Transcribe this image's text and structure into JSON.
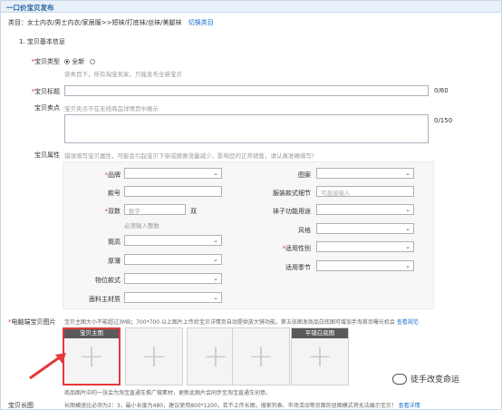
{
  "header": {
    "title": "一口价宝贝发布"
  },
  "category": {
    "prefix": "类目：",
    "path": "女士内衣/男士内衣/家居服>>短袜/打底袜/丝袜/美腿袜",
    "switch_label": "切换类目"
  },
  "section_title": "1. 宝贝基本信息",
  "item_type": {
    "label": "宝贝类型",
    "option_new": "全新",
    "hint": "该类目下，所有淘宝卖家，只能发布全新宝贝"
  },
  "item_title": {
    "label": "宝贝标题",
    "counter": "0/60"
  },
  "selling_point": {
    "label": "宝贝卖点",
    "hint": "宝贝卖点不在无线商品详情页中展示",
    "counter": "0/150"
  },
  "attributes": {
    "label": "宝贝属性",
    "hint": "错误填写宝贝属性，可能会引起宝贝下架或搜索流量减少，影响您的正常销售，请认真准确填写！",
    "left": [
      {
        "label": "品牌",
        "required": true,
        "kind": "select",
        "value": ""
      },
      {
        "label": "款号",
        "required": false,
        "kind": "input",
        "value": ""
      },
      {
        "label": "双数",
        "required": true,
        "kind": "input",
        "value": "数字",
        "suffix": "双",
        "note": "必须输入整数"
      },
      {
        "label": "筒高",
        "required": false,
        "kind": "select",
        "value": ""
      },
      {
        "label": "厚薄",
        "required": false,
        "kind": "select",
        "value": ""
      },
      {
        "label": "物位款式",
        "required": false,
        "kind": "select",
        "value": ""
      },
      {
        "label": "面料主材质",
        "required": false,
        "kind": "select",
        "value": ""
      }
    ],
    "right": [
      {
        "label": "图案",
        "required": false,
        "kind": "select",
        "value": ""
      },
      {
        "label": "服装款式细节",
        "required": false,
        "kind": "input",
        "value": "可直接输入"
      },
      {
        "label": "袜子功能用途",
        "required": false,
        "kind": "select",
        "value": ""
      },
      {
        "label": "风格",
        "required": false,
        "kind": "select",
        "value": ""
      },
      {
        "label": "适用性别",
        "required": true,
        "kind": "select",
        "value": ""
      },
      {
        "label": "适用季节",
        "required": false,
        "kind": "select",
        "value": ""
      }
    ]
  },
  "main_image": {
    "label": "电脑端宝贝图片",
    "hint": "宝贝主图大小不能超过3MB；700*700 以上图片上传后宝贝详情页自动提供放大镜功能。第五张图发商品白底图可增加手淘首页曝光机会",
    "link": "查看规范",
    "slots": [
      {
        "caption": "宝贝主图"
      },
      {
        "caption": ""
      },
      {
        "caption": ""
      },
      {
        "caption": ""
      },
      {
        "caption": "平铺白底图"
      }
    ],
    "note": "商品图片中的一张会为淘宝直通车推广做素材，更新此图片会同步至淘宝直通车创意。"
  },
  "long_image": {
    "label": "宝贝长图",
    "hint": "长图横竖比必须为2：3，最小长度为480，建议使用800*1200，若不上传长图，搜索列表、市场活动等页面的竖图模式将无法展示宝贝！",
    "link": "查看详情"
  },
  "watermark": {
    "text": "徒手改变命运"
  },
  "icons": [
    "dropdown-arrow-icon",
    "plus-icon",
    "radio-icon",
    "arrow-annotation-icon",
    "wechat-logo-icon"
  ],
  "colors": {
    "required": "#e4393c",
    "link": "#1a6fd1",
    "highlight": "#e4393c"
  }
}
